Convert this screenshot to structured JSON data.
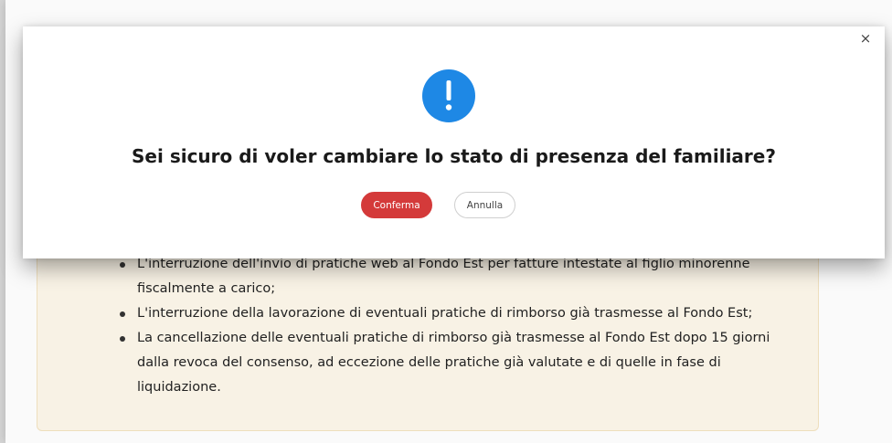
{
  "modal": {
    "title": "Sei sicuro di voler cambiare lo stato di presenza del familiare?",
    "close_label": "×",
    "icon": "exclamation-icon",
    "accent_color": "#1e88e5",
    "confirm_label": "Conferma",
    "confirm_color": "#d43a3a",
    "cancel_label": "Annulla"
  },
  "notice": {
    "items": [
      "L'interruzione dell'invio di pratiche web al Fondo Est per fatture intestate al figlio minorenne fiscalmente a carico;",
      "L'interruzione della lavorazione di eventuali pratiche di rimborso già trasmesse al Fondo Est;",
      "La cancellazione delle eventuali pratiche di rimborso già trasmesse al Fondo Est dopo 15 giorni dalla revoca del consenso, ad eccezione delle pratiche già valutate e di quelle in fase di liquidazione."
    ]
  }
}
